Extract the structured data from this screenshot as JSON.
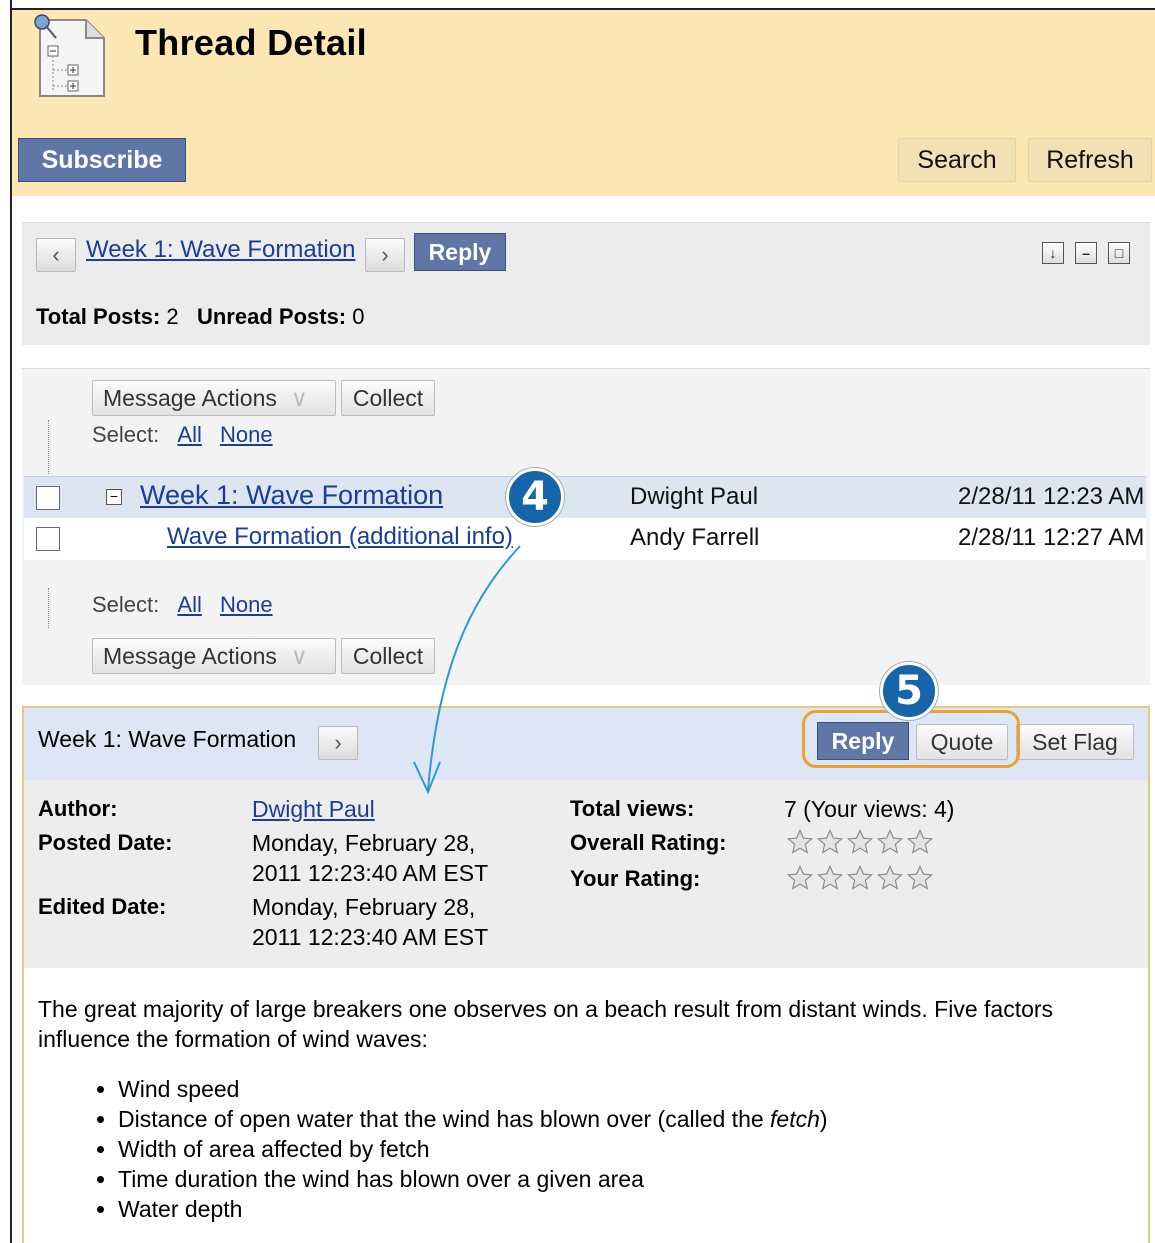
{
  "header": {
    "title": "Thread Detail",
    "subscribe_label": "Subscribe",
    "search_label": "Search",
    "refresh_label": "Refresh"
  },
  "thread_nav": {
    "thread_title": "Week 1: Wave Formation",
    "reply_label": "Reply",
    "total_posts_label": "Total Posts:",
    "total_posts_value": "2",
    "unread_posts_label": "Unread Posts:",
    "unread_posts_value": "0"
  },
  "message_list": {
    "message_actions_label": "Message Actions",
    "collect_label": "Collect",
    "select_label": "Select:",
    "all_label": "All",
    "none_label": "None",
    "rows": [
      {
        "title": "Week 1: Wave Formation",
        "author": "Dwight Paul",
        "date": "2/28/11 12:23 AM"
      },
      {
        "title": "Wave Formation (additional info)",
        "author": "Andy Farrell",
        "date": "2/28/11 12:27 AM"
      }
    ]
  },
  "callouts": {
    "step4": "4",
    "step5": "5"
  },
  "post": {
    "title": "Week 1: Wave Formation",
    "reply_label": "Reply",
    "quote_label": "Quote",
    "set_flag_label": "Set Flag",
    "author_label": "Author:",
    "author_value": "Dwight Paul",
    "posted_date_label": "Posted Date:",
    "posted_date_line1": "Monday, February 28,",
    "posted_date_line2": "2011 12:23:40 AM EST",
    "edited_date_label": "Edited Date:",
    "edited_date_line1": "Monday, February 28,",
    "edited_date_line2": "2011 12:23:40 AM EST",
    "total_views_label": "Total views:",
    "total_views_value": "7 (Your views: 4)",
    "overall_rating_label": "Overall Rating:",
    "overall_rating_value": 0,
    "your_rating_label": "Your Rating:",
    "your_rating_value": 0,
    "body_paragraph": "The great majority of large breakers one observes on a beach result from distant winds. Five factors influence the formation of wind waves:",
    "bullets": [
      "Wind speed",
      "Width of area affected by fetch",
      "Time duration the wind has blown over a given area",
      "Water depth"
    ],
    "bullet_fetch_prefix": "Distance of open water that the wind has blown over (called the ",
    "bullet_fetch_em": "fetch",
    "bullet_fetch_suffix": ")"
  },
  "colors": {
    "header_bg": "#fbe6b4",
    "primary_button": "#5f77a6",
    "link": "#1a3d99",
    "callout": "#1565a8",
    "highlight_ring": "#f0a030"
  }
}
